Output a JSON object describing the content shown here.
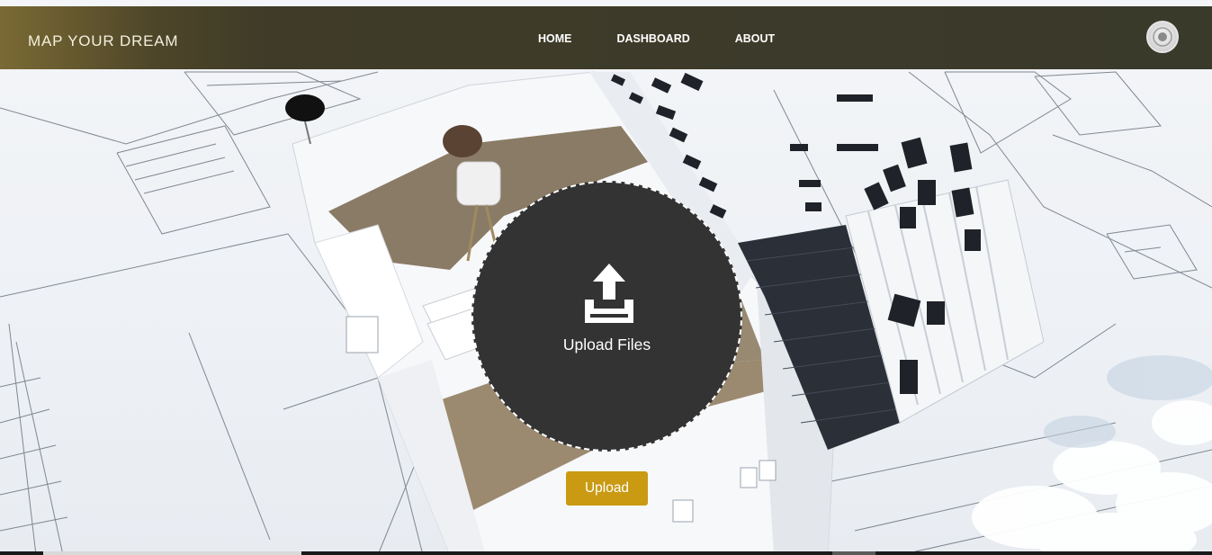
{
  "navbar": {
    "brand": "MAP YOUR DREAM",
    "links": [
      {
        "label": "HOME"
      },
      {
        "label": "DASHBOARD"
      },
      {
        "label": "ABOUT"
      }
    ],
    "avatar_icon": "user-avatar-icon"
  },
  "upload": {
    "zone_label": "Upload Files",
    "icon": "upload-icon",
    "button_label": "Upload"
  },
  "colors": {
    "navbar_bg": "#3a3a2b",
    "navbar_accent": "#7a6a34",
    "upload_zone_bg": "#333333",
    "button_bg": "#c99a12",
    "text_light": "#ffffff"
  }
}
